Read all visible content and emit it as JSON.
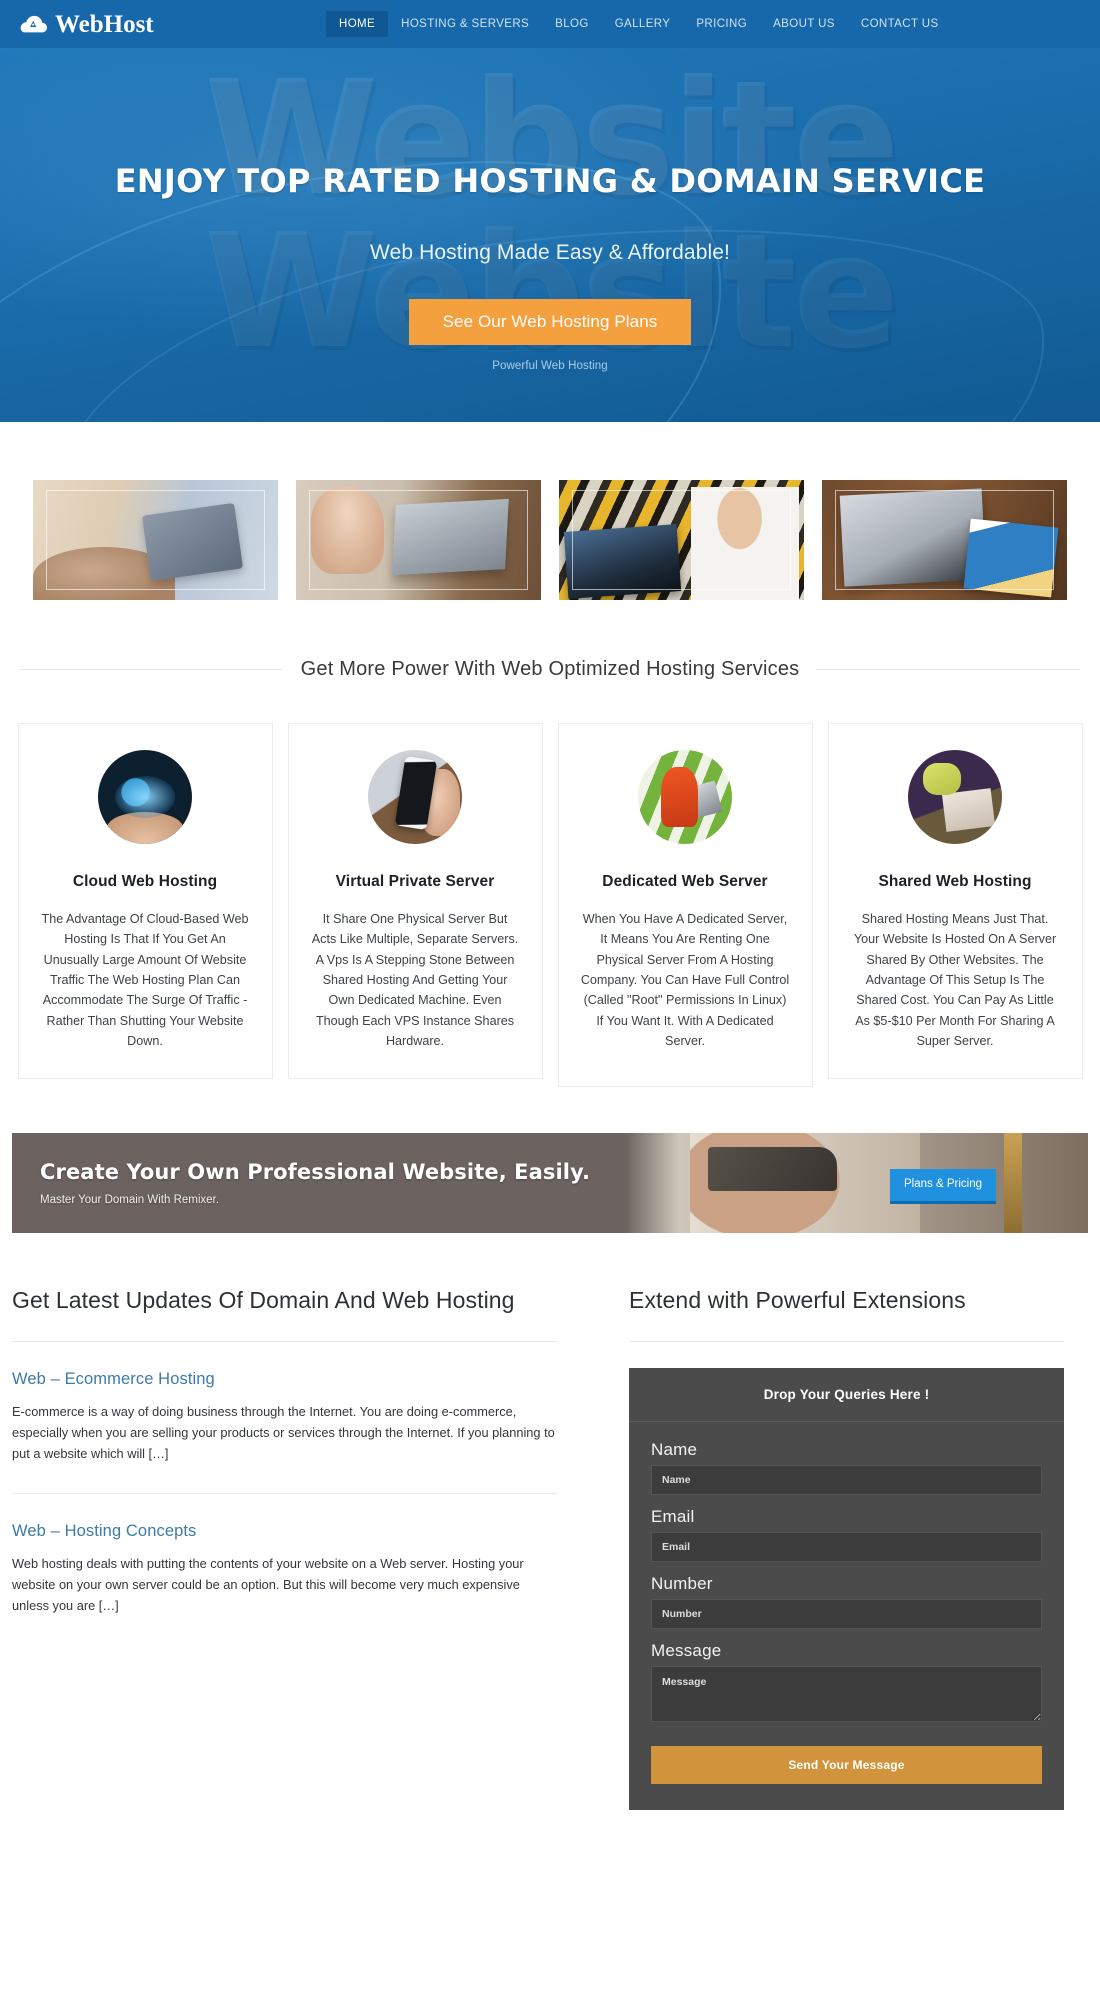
{
  "brand": {
    "name": "WebHost",
    "icon": "cloud-icon",
    "header_bg": "#1768ab",
    "accent_orange": "#f4a03f",
    "accent_blue": "#2091df"
  },
  "nav": {
    "items": [
      {
        "label": "HOME",
        "active": true
      },
      {
        "label": "HOSTING & SERVERS",
        "active": false
      },
      {
        "label": "BLOG",
        "active": false
      },
      {
        "label": "GALLERY",
        "active": false
      },
      {
        "label": "PRICING",
        "active": false
      },
      {
        "label": "ABOUT US",
        "active": false
      },
      {
        "label": "CONTACT US",
        "active": false
      }
    ]
  },
  "hero": {
    "watermark": "Website",
    "title": "ENJOY TOP RATED HOSTING & DOMAIN SERVICE",
    "subtitle": "Web Hosting Made Easy & Affordable!",
    "cta_label": "See Our Web Hosting Plans",
    "caption": "Powerful Web Hosting"
  },
  "gallery": {
    "items": [
      {
        "name": "hands-on-tablet-photo"
      },
      {
        "name": "person-typing-laptop-photo"
      },
      {
        "name": "man-holding-laptop-photo"
      },
      {
        "name": "desk-laptop-tablet-photo"
      }
    ]
  },
  "services": {
    "heading": "Get More Power With Web Optimized Hosting Services",
    "cards": [
      {
        "title": "Cloud Web Hosting",
        "body": "The Advantage Of Cloud-Based Web Hosting Is That If You Get An Unusually Large Amount Of Website Traffic The Web Hosting Plan Can Accommodate The Surge Of Traffic - Rather Than Shutting Your Website Down.",
        "image": "cloud-network-hands-photo"
      },
      {
        "title": "Virtual Private Server",
        "body": "It Share One Physical Server But Acts Like Multiple, Separate Servers. A Vps Is A Stepping Stone Between Shared Hosting And Getting Your Own Dedicated Machine. Even Though Each VPS Instance Shares Hardware.",
        "image": "hand-holding-phone-photo"
      },
      {
        "title": "Dedicated Web Server",
        "body": "When You Have A Dedicated Server, It Means You Are Renting One Physical Server From A Hosting Company. You Can Have Full Control (Called \"Root\" Permissions In Linux) If You Want It. With A Dedicated Server.",
        "image": "person-laptop-grass-photo"
      },
      {
        "title": "Shared Web Hosting",
        "body": "Shared Hosting Means Just That. Your Website Is Hosted On A Server Shared By Other Websites. The Advantage Of This Setup Is The Shared Cost. You Can Pay As Little As $5-$10 Per Month For Sharing A Super Server.",
        "image": "woman-on-couch-laptop-photo"
      }
    ]
  },
  "promo": {
    "heading": "Create Your Own Professional Website, Easily.",
    "subheading": "Master Your Domain With Remixer.",
    "button_label": "Plans & Pricing"
  },
  "blog": {
    "heading": "Get Latest Updates Of Domain And Web Hosting",
    "posts": [
      {
        "title": "Web – Ecommerce Hosting",
        "excerpt": "E-commerce is a way of doing business through the Internet. You are doing e-commerce, especially when you are selling your products or services through the Internet. If you planning to put a website which will […]"
      },
      {
        "title": "Web – Hosting Concepts",
        "excerpt": "Web hosting deals with putting the contents of your website on a Web server. Hosting your website on your own server could be an option. But this will become very much expensive unless you are […]"
      }
    ]
  },
  "extensions": {
    "heading": "Extend with Powerful Extensions",
    "form": {
      "title": "Drop Your Queries Here !",
      "fields": [
        {
          "label": "Name",
          "placeholder": "Name",
          "value": ""
        },
        {
          "label": "Email",
          "placeholder": "Email",
          "value": ""
        },
        {
          "label": "Number",
          "placeholder": "Number",
          "value": ""
        }
      ],
      "message": {
        "label": "Message",
        "placeholder": "Message",
        "value": ""
      },
      "submit_label": "Send Your Message"
    }
  }
}
